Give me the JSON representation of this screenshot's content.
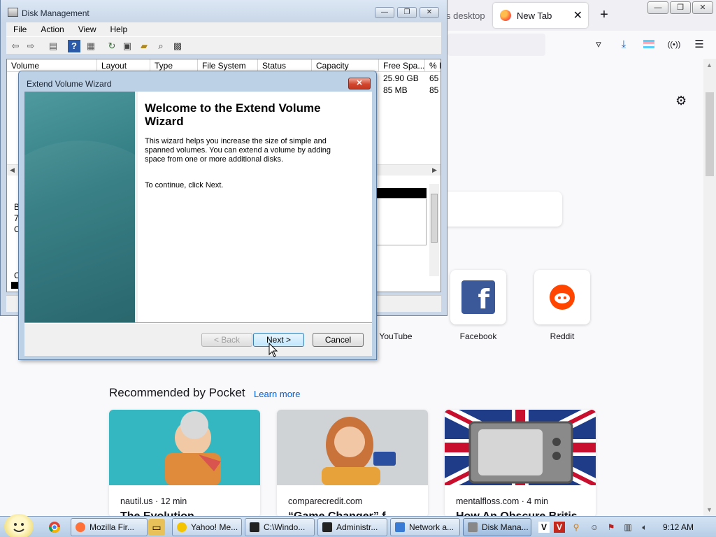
{
  "firefox": {
    "tabs": [
      {
        "label": "s desktop"
      },
      {
        "label": "New Tab"
      }
    ],
    "new_tab_symbol": "+",
    "close_symbol": "✕",
    "shortcuts": [
      {
        "label": "YouTube"
      },
      {
        "label": "Facebook",
        "icon": "facebook-icon"
      },
      {
        "label": "Reddit",
        "icon": "reddit-icon"
      }
    ],
    "pocket": {
      "heading": "Recommended by Pocket",
      "learn_more": "Learn more",
      "cards": [
        {
          "source": "nautil.us · 12 min",
          "title": "The Evolution"
        },
        {
          "source": "comparecredit.com",
          "title": "“Game Changer” f"
        },
        {
          "source": "mentalfloss.com · 4 min",
          "title": "How An Obscure Britis"
        }
      ]
    }
  },
  "disk_management": {
    "title": "Disk Management",
    "menu": [
      "File",
      "Action",
      "View",
      "Help"
    ],
    "columns": [
      "Volume",
      "Layout",
      "Type",
      "File System",
      "Status",
      "Capacity",
      "Free Spa...",
      "% F"
    ],
    "rows": [
      {
        "free_space": "25.90 GB",
        "percent": "65"
      },
      {
        "free_space": "85 MB",
        "percent": "85"
      }
    ],
    "lower_pane_fragments": [
      "B",
      "7.",
      "O",
      "C"
    ]
  },
  "wizard": {
    "title": "Extend Volume Wizard",
    "heading": "Welcome to the Extend Volume Wizard",
    "description": "This wizard helps you increase the size of simple and spanned volumes. You can extend a volume  by adding space from one or more additional disks.",
    "continue_text": "To continue, click Next.",
    "buttons": {
      "back": "< Back",
      "next": "Next >",
      "cancel": "Cancel"
    },
    "banner_color": "#2f7a80"
  },
  "taskbar": {
    "buttons": [
      {
        "label": "Mozilla Fir...",
        "icon": "firefox-icon",
        "color": "#ff7139"
      },
      {
        "label": "Yahoo! Me...",
        "icon": "yahoo-messenger-icon",
        "color": "#f5c400"
      },
      {
        "label": "C:\\Windo...",
        "icon": "cmd-icon",
        "color": "#222222"
      },
      {
        "label": "Administr...",
        "icon": "cmd-icon",
        "color": "#222222"
      },
      {
        "label": "Network a...",
        "icon": "network-icon",
        "color": "#3a7bd5"
      },
      {
        "label": "Disk Mana...",
        "icon": "disk-management-icon",
        "color": "#888888"
      }
    ],
    "clock": "9:12 AM"
  }
}
